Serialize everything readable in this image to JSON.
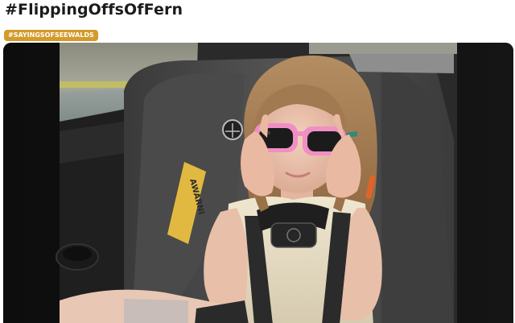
{
  "post": {
    "hashtag_title": "#FlippingOffsOfFern",
    "tag_label": "#SAYINGSOFSEEWALDS"
  },
  "video": {
    "car_seat_label": "AWARNI"
  }
}
